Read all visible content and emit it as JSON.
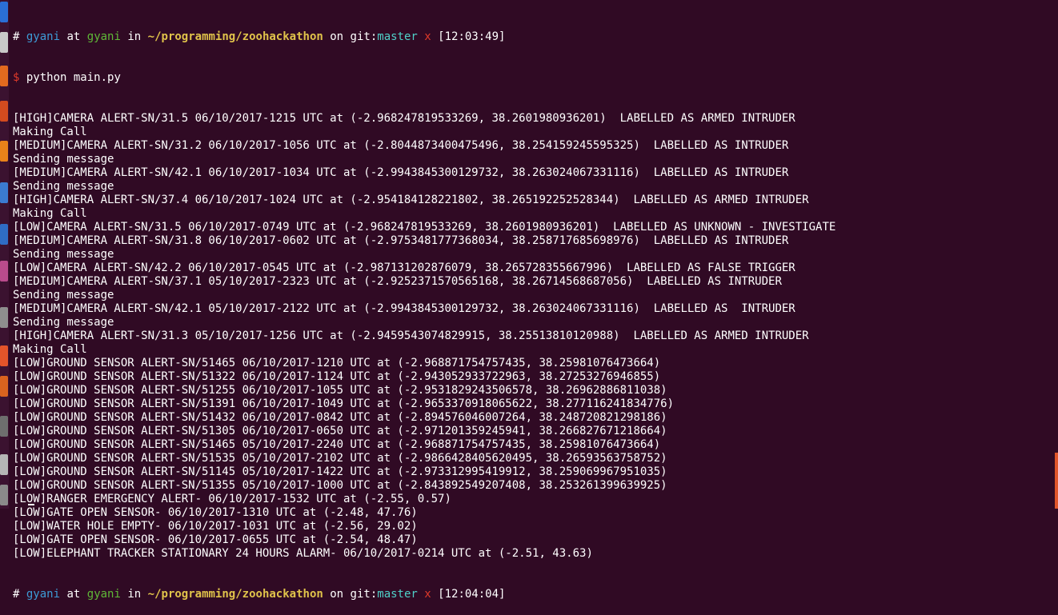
{
  "prompt_start": {
    "hash": "#",
    "user": "gyani",
    "at": "at",
    "host": "gyani",
    "in": "in",
    "path": "~/programming/zoohackathon",
    "on": "on",
    "git": "git:",
    "branch": "master",
    "dirty": "x",
    "time": "[12:03:49]"
  },
  "command": {
    "dollar": "$",
    "text": "python main.py"
  },
  "output_lines": [
    "[HIGH]CAMERA ALERT-SN/31.5 06/10/2017-1215 UTC at (-2.968247819533269, 38.2601980936201)  LABELLED AS ARMED INTRUDER",
    "Making Call",
    "[MEDIUM]CAMERA ALERT-SN/31.2 06/10/2017-1056 UTC at (-2.8044873400475496, 38.254159245595325)  LABELLED AS INTRUDER",
    "Sending message",
    "[MEDIUM]CAMERA ALERT-SN/42.1 06/10/2017-1034 UTC at (-2.9943845300129732, 38.263024067331116)  LABELLED AS INTRUDER",
    "Sending message",
    "[HIGH]CAMERA ALERT-SN/37.4 06/10/2017-1024 UTC at (-2.954184128221802, 38.265192252528344)  LABELLED AS ARMED INTRUDER",
    "Making Call",
    "[LOW]CAMERA ALERT-SN/31.5 06/10/2017-0749 UTC at (-2.968247819533269, 38.2601980936201)  LABELLED AS UNKNOWN - INVESTIGATE",
    "[MEDIUM]CAMERA ALERT-SN/31.8 06/10/2017-0602 UTC at (-2.9753481777368034, 38.258717685698976)  LABELLED AS INTRUDER",
    "Sending message",
    "[LOW]CAMERA ALERT-SN/42.2 06/10/2017-0545 UTC at (-2.987131202876079, 38.265728355667996)  LABELLED AS FALSE TRIGGER",
    "[MEDIUM]CAMERA ALERT-SN/37.1 05/10/2017-2323 UTC at (-2.9252371570565168, 38.26714568687056)  LABELLED AS INTRUDER",
    "Sending message",
    "[MEDIUM]CAMERA ALERT-SN/42.1 05/10/2017-2122 UTC at (-2.9943845300129732, 38.263024067331116)  LABELLED AS  INTRUDER",
    "Sending message",
    "[HIGH]CAMERA ALERT-SN/31.3 05/10/2017-1256 UTC at (-2.9459543074829915, 38.25513810120988)  LABELLED AS ARMED INTRUDER",
    "Making Call",
    "[LOW]GROUND SENSOR ALERT-SN/51465 06/10/2017-1210 UTC at (-2.968871754757435, 38.25981076473664)",
    "[LOW]GROUND SENSOR ALERT-SN/51322 06/10/2017-1124 UTC at (-2.943052933722963, 38.27253276946855)",
    "[LOW]GROUND SENSOR ALERT-SN/51255 06/10/2017-1055 UTC at (-2.9531829243506578, 38.26962886811038)",
    "[LOW]GROUND SENSOR ALERT-SN/51391 06/10/2017-1049 UTC at (-2.9653370918065622, 38.277116241834776)",
    "[LOW]GROUND SENSOR ALERT-SN/51432 06/10/2017-0842 UTC at (-2.894576046007264, 38.248720821298186)",
    "[LOW]GROUND SENSOR ALERT-SN/51305 06/10/2017-0650 UTC at (-2.971201359245941, 38.266827671218664)",
    "[LOW]GROUND SENSOR ALERT-SN/51465 05/10/2017-2240 UTC at (-2.968871754757435, 38.25981076473664)",
    "[LOW]GROUND SENSOR ALERT-SN/51535 05/10/2017-2102 UTC at (-2.9866428405620495, 38.26593563758752)",
    "[LOW]GROUND SENSOR ALERT-SN/51145 05/10/2017-1422 UTC at (-2.973312995419912, 38.259069967951035)",
    "[LOW]GROUND SENSOR ALERT-SN/51355 05/10/2017-1000 UTC at (-2.843892549207408, 38.253261399639925)",
    "[LOW]RANGER EMERGENCY ALERT- 06/10/2017-1532 UTC at (-2.55, 0.57)",
    "[LOW]GATE OPEN SENSOR- 06/10/2017-1310 UTC at (-2.48, 47.76)",
    "[LOW]WATER HOLE EMPTY- 06/10/2017-1031 UTC at (-2.56, 29.02)",
    "[LOW]GATE OPEN SENSOR- 06/10/2017-0655 UTC at (-2.54, 48.47)",
    "[LOW]ELEPHANT TRACKER STATIONARY 24 HOURS ALARM- 06/10/2017-0214 UTC at (-2.51, 43.63)"
  ],
  "prompt_end": {
    "hash": "#",
    "user": "gyani",
    "at": "at",
    "host": "gyani",
    "in": "in",
    "path": "~/programming/zoohackathon",
    "on": "on",
    "git": "git:",
    "branch": "master",
    "dirty": "x",
    "time": "[12:04:04]"
  },
  "colors": {
    "background": "#300a24",
    "user": "#3d9bd6",
    "host": "#5fb837",
    "path": "#e0c34a",
    "branch": "#4fd0c8",
    "dirty": "#e03a2a"
  }
}
